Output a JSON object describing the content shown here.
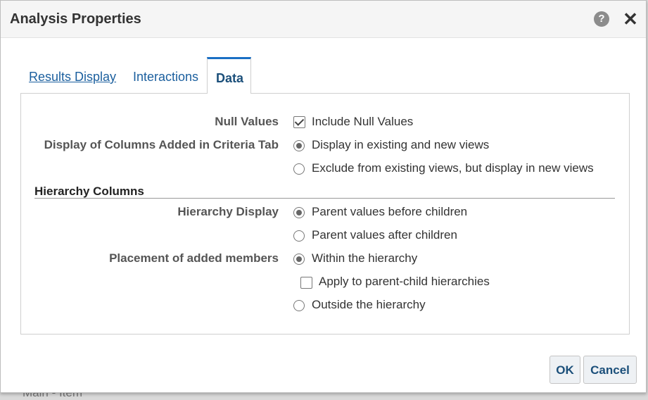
{
  "background": {
    "peek_text": "Main - Item"
  },
  "dialog": {
    "title": "Analysis Properties",
    "help_icon": "question-circle-icon",
    "close_icon": "close-icon"
  },
  "tabs": [
    {
      "label": "Results Display",
      "active": false
    },
    {
      "label": "Interactions",
      "active": false
    },
    {
      "label": "Data",
      "active": true
    }
  ],
  "form": {
    "null_values": {
      "label": "Null Values",
      "option": "Include Null Values",
      "checked": true
    },
    "criteria_columns": {
      "label": "Display of Columns Added in Criteria Tab",
      "options": [
        {
          "label": "Display in existing and new views",
          "selected": true
        },
        {
          "label": "Exclude from existing views, but display in new views",
          "selected": false
        }
      ]
    },
    "hierarchy_section": {
      "title": "Hierarchy Columns"
    },
    "hierarchy_display": {
      "label": "Hierarchy Display",
      "options": [
        {
          "label": "Parent values before children",
          "selected": true
        },
        {
          "label": "Parent values after children",
          "selected": false
        }
      ]
    },
    "placement": {
      "label": "Placement of added members",
      "options": [
        {
          "label": "Within the hierarchy",
          "selected": true
        },
        {
          "label": "Outside the hierarchy",
          "selected": false
        }
      ],
      "sub_option": {
        "label": "Apply to parent-child hierarchies",
        "checked": false
      }
    }
  },
  "buttons": {
    "ok": "OK",
    "cancel": "Cancel"
  },
  "colors": {
    "accent": "#1a6fc4",
    "link": "#1b5f9e",
    "header_bg": "#f5f5f5"
  }
}
